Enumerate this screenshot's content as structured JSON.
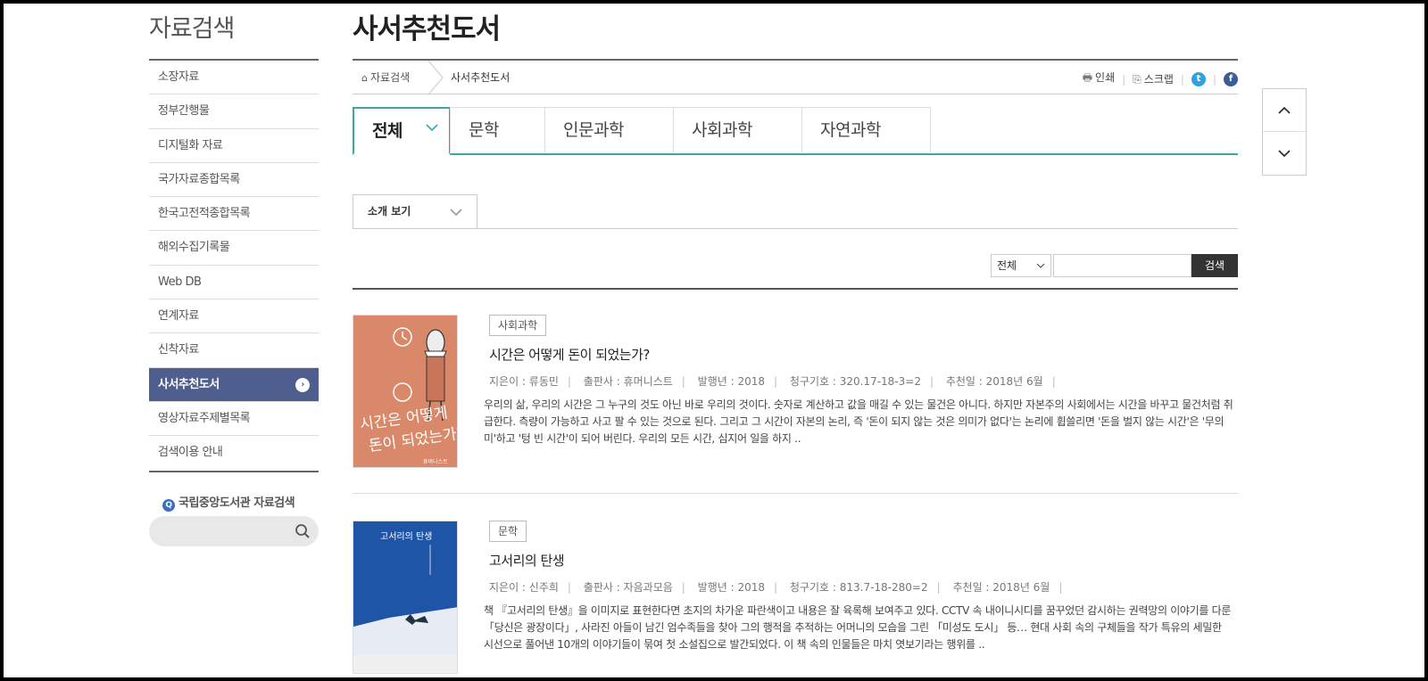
{
  "sidebar": {
    "title": "자료검색",
    "items": [
      {
        "label": "소장자료"
      },
      {
        "label": "정부간행물"
      },
      {
        "label": "디지털화 자료"
      },
      {
        "label": "국가자료종합목록"
      },
      {
        "label": "한국고전적종합목록"
      },
      {
        "label": "해외수집기록물"
      },
      {
        "label": "Web DB"
      },
      {
        "label": "연계자료"
      },
      {
        "label": "신착자료"
      },
      {
        "label": "사서추천도서",
        "active": true
      },
      {
        "label": "영상자료주제별목록"
      },
      {
        "label": "검색이용 안내"
      }
    ],
    "nl_search_title": "국립중앙도서관 자료검색"
  },
  "header": {
    "page_title": "사서추천도서",
    "breadcrumb_home": "자료검색",
    "breadcrumb_current": "사서추천도서",
    "print_label": "인쇄",
    "scrap_label": "스크랩"
  },
  "tabs": [
    {
      "label": "전체",
      "active": true
    },
    {
      "label": "문학"
    },
    {
      "label": "인문과학"
    },
    {
      "label": "사회과학"
    },
    {
      "label": "자연과학"
    }
  ],
  "view_select": {
    "label": "소개 보기"
  },
  "search": {
    "select_value": "전체",
    "button_label": "검색"
  },
  "books": [
    {
      "category": "사회과학",
      "title": "시간은 어떻게 돈이 되었는가?",
      "author": "지은이 : 류동민",
      "publisher": "출판사 : 휴머니스트",
      "year": "발행년 : 2018",
      "call_no": "청구기호 : 320.17-18-3=2",
      "recommended": "추천일 : 2018년 6월",
      "description": "우리의 삶, 우리의 시간은 그 누구의 것도 아닌 바로 우리의 것이다. 숫자로 계산하고 값을 매길 수 있는 물건은 아니다. 하지만 자본주의 사회에서는 시간을 바꾸고 물건처럼 취급한다. 측량이 가능하고 사고 팔 수 있는 것으로 된다. 그리고 그 시간이 자본의 논리, 즉 '돈이 되지 않는 것은 의미가 없다'는 논리에 휩쓸리면 '돈을 벌지 않는 시간'은 '무의미'하고 '텅 빈 시간'이 되어 버린다. 우리의 모든 시간, 심지어 일을 하지 ..",
      "cover_title_text": "시간은 어떻게 돈이 되었는가?",
      "cover_publisher": "휴머니스트"
    },
    {
      "category": "문학",
      "title": "고서리의 탄생",
      "author": "지은이 : 신주희",
      "publisher": "출판사 : 자음과모음",
      "year": "발행년 : 2018",
      "call_no": "청구기호 : 813.7-18-280=2",
      "recommended": "추천일 : 2018년 6월",
      "description": "책 『고서리의 탄생』을 이미지로 표현한다면 초지의 차가운 파란색이고 내용은 잘 육록해 보여주고 있다. CCTV 속 내이니시디를 꿈꾸었던 감시하는 권력망의 이야기를 다룬 「당신은 광장이다」, 사라진 아들이 남긴 엄수족들을 찾아 그의 행적을 추적하는 어머니의 모습을 그린 「미성도 도시」 등… 현대 사회 속의 구체들을 작가 특유의 세밀한 시선으로 풀어낸 10개의 이야기들이 묶여 첫 소설집으로 발간되었다. 이 책 속의 인물들은 마치 엿보기라는 행위를 ..",
      "cover_title_text": "고서리의 탄생"
    }
  ],
  "colors": {
    "accent": "#3aa7a6",
    "sidebar_active": "#4e5e8e",
    "cover1": "#d9886a",
    "cover2": "#1f55a6"
  }
}
